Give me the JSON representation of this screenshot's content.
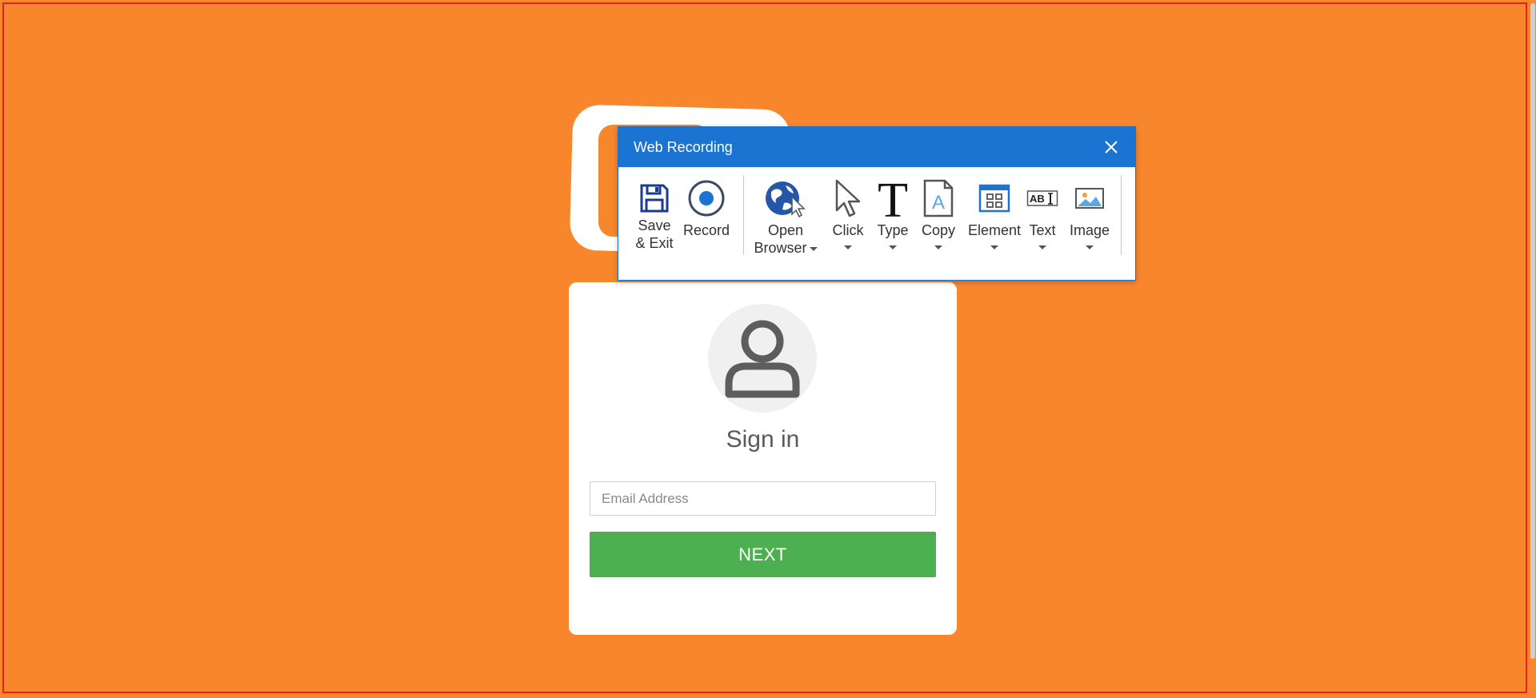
{
  "window": {
    "title": "Web Recording",
    "close_icon": "close-icon"
  },
  "toolbar": {
    "items": [
      {
        "label_line1": "Save",
        "label_line2": "& Exit",
        "icon": "save-icon"
      },
      {
        "label_line1": "Record",
        "icon": "record-icon"
      },
      {
        "label_line1": "Open",
        "label_line2": "Browser",
        "icon": "open-browser-icon"
      },
      {
        "label_line1": "Click",
        "icon": "click-icon"
      },
      {
        "label_line1": "Type",
        "icon": "type-icon"
      },
      {
        "label_line1": "Copy",
        "icon": "copy-icon"
      },
      {
        "label_line1": "Element",
        "icon": "element-icon"
      },
      {
        "label_line1": "Text",
        "icon": "text-icon"
      },
      {
        "label_line1": "Image",
        "icon": "image-icon"
      }
    ]
  },
  "signin": {
    "title": "Sign in",
    "email_placeholder": "Email Address",
    "email_value": "",
    "next_label": "NEXT",
    "avatar_icon": "user-icon"
  },
  "colors": {
    "background": "#f8862d",
    "titlebar": "#1b74d2",
    "button": "#4caf50",
    "frame": "#e8221a"
  }
}
